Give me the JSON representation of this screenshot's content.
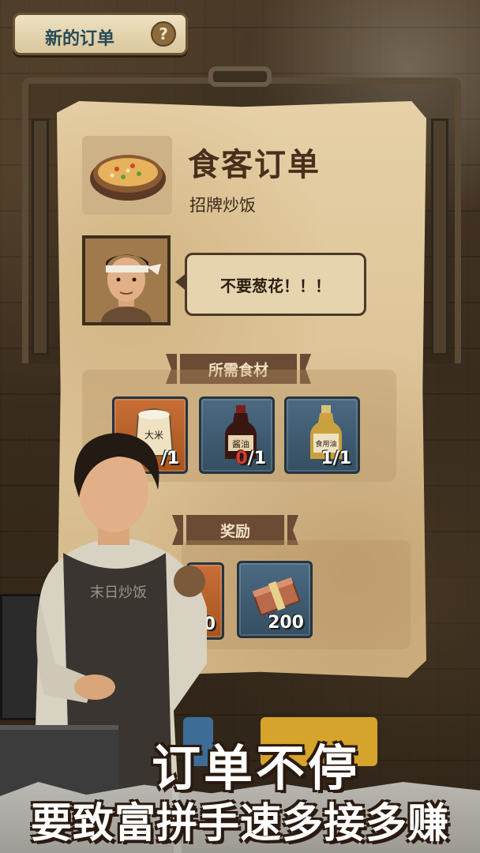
{
  "header": {
    "title": "新的订单",
    "help_icon": "help-icon"
  },
  "order": {
    "title": "食客订单",
    "dish_name": "招牌炒饭",
    "dish_icon": "fried-rice-icon",
    "customer_avatar": "customer-portrait",
    "request": "不要葱花！！！"
  },
  "ingredients": {
    "header": "所需食材",
    "items": [
      {
        "icon": "rice-bag-icon",
        "label": "大米",
        "count_have": "",
        "count_sep": "/1",
        "color": "#c86e36"
      },
      {
        "icon": "soy-sauce-icon",
        "label": "酱油",
        "count_have": "0",
        "count_sep": "/1",
        "color": "#4b6a82"
      },
      {
        "icon": "cooking-oil-icon",
        "label": "食用油",
        "count_have": "1",
        "count_sep": "/1",
        "color": "#4b6a82"
      }
    ]
  },
  "rewards": {
    "header": "奖励",
    "items": [
      {
        "icon": "reward-icon-hidden",
        "value": "0",
        "color": "#c86e36"
      },
      {
        "icon": "cash-stack-icon",
        "value": "200",
        "color": "#4b6a82"
      }
    ]
  },
  "character": {
    "apron_text": "末日炒饭"
  },
  "captions": {
    "line1": "订单不停",
    "line2": "要致富拼手速多接多赚"
  }
}
